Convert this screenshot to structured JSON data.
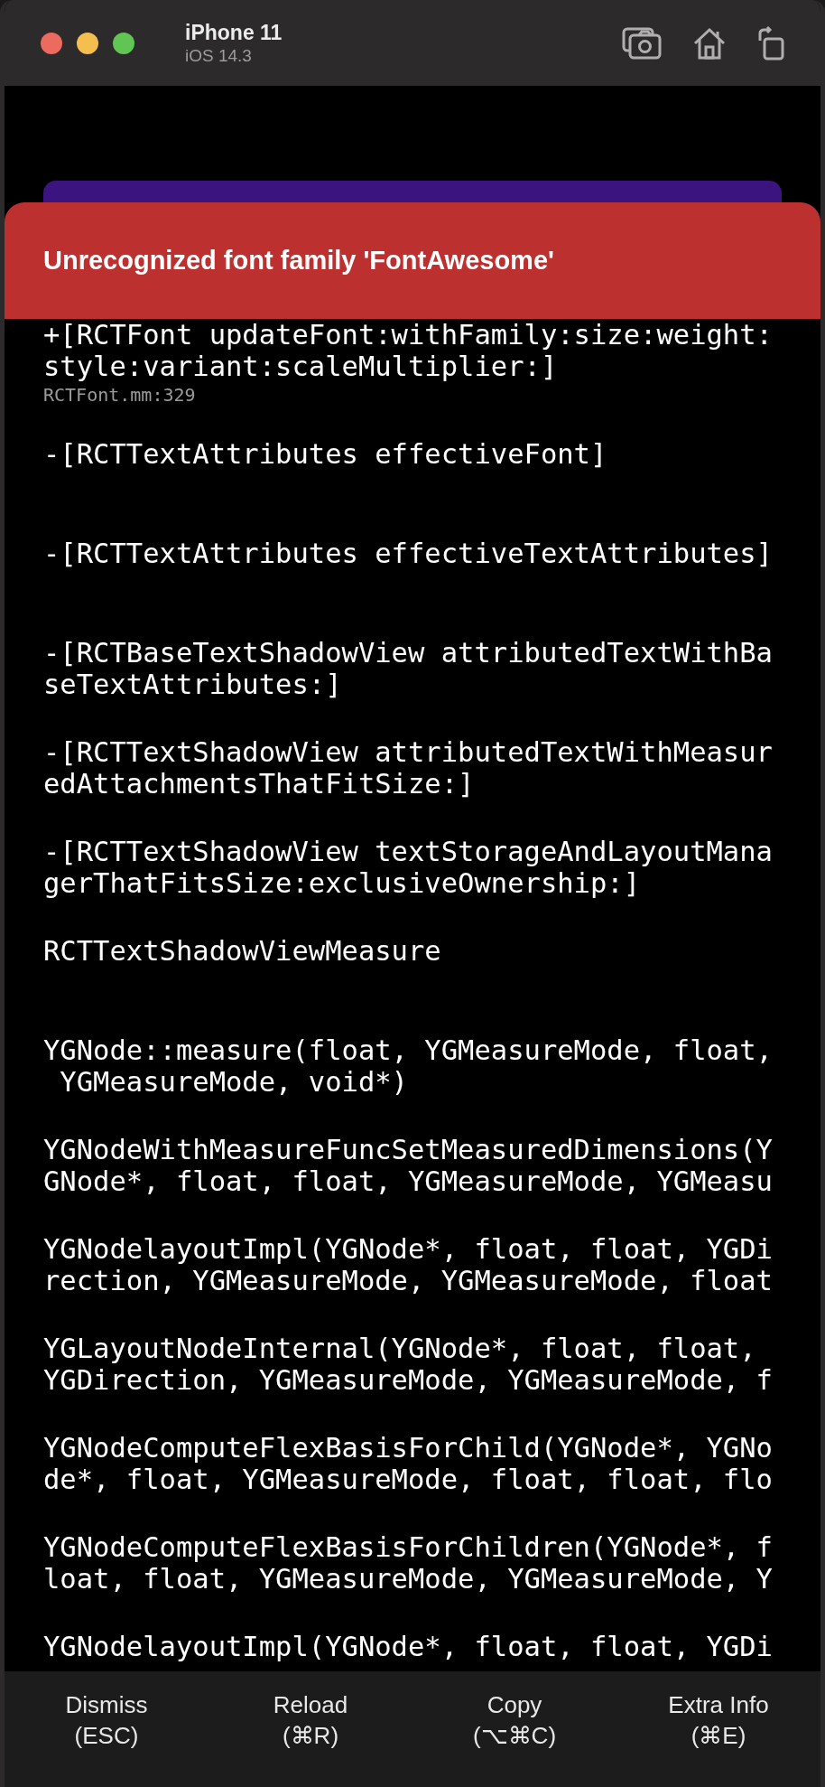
{
  "window": {
    "title": "iPhone 11",
    "subtitle": "iOS 14.3"
  },
  "error": {
    "title": "Unrecognized font family 'FontAwesome'"
  },
  "stack": [
    {
      "lines": [
        "+[RCTFont updateFont:withFamily:size:weight:",
        "style:variant:scaleMultiplier:]"
      ],
      "file": "RCTFont.mm:329"
    },
    {
      "lines": [
        "-[RCTTextAttributes effectiveFont]"
      ]
    },
    {
      "lines": [
        "-[RCTTextAttributes effectiveTextAttributes]"
      ]
    },
    {
      "lines": [
        "-[RCTBaseTextShadowView attributedTextWithBa",
        "seTextAttributes:]"
      ]
    },
    {
      "lines": [
        "-[RCTTextShadowView attributedTextWithMeasur",
        "edAttachmentsThatFitSize:]"
      ]
    },
    {
      "lines": [
        "-[RCTTextShadowView textStorageAndLayoutMana",
        "gerThatFitsSize:exclusiveOwnership:]"
      ]
    },
    {
      "lines": [
        "RCTTextShadowViewMeasure"
      ]
    },
    {
      "lines": [
        "YGNode::measure(float, YGMeasureMode, float,",
        " YGMeasureMode, void*)"
      ]
    },
    {
      "lines": [
        "YGNodeWithMeasureFuncSetMeasuredDimensions(Y",
        "GNode*, float, float, YGMeasureMode, YGMeasu"
      ]
    },
    {
      "lines": [
        "YGNodelayoutImpl(YGNode*, float, float, YGDi",
        "rection, YGMeasureMode, YGMeasureMode, float"
      ]
    },
    {
      "lines": [
        "YGLayoutNodeInternal(YGNode*, float, float,",
        "YGDirection, YGMeasureMode, YGMeasureMode, f"
      ]
    },
    {
      "lines": [
        "YGNodeComputeFlexBasisForChild(YGNode*, YGNo",
        "de*, float, YGMeasureMode, float, float, flo"
      ]
    },
    {
      "lines": [
        "YGNodeComputeFlexBasisForChildren(YGNode*, f",
        "loat, float, YGMeasureMode, YGMeasureMode, Y"
      ]
    },
    {
      "lines": [
        "YGNodelayoutImpl(YGNode*, float, float, YGDi"
      ]
    }
  ],
  "buttons": [
    {
      "label": "Dismiss",
      "shortcut": "(ESC)"
    },
    {
      "label": "Reload",
      "shortcut": "(⌘R)"
    },
    {
      "label": "Copy",
      "shortcut": "(⌥⌘C)"
    },
    {
      "label": "Extra Info",
      "shortcut": "(⌘E)"
    }
  ]
}
